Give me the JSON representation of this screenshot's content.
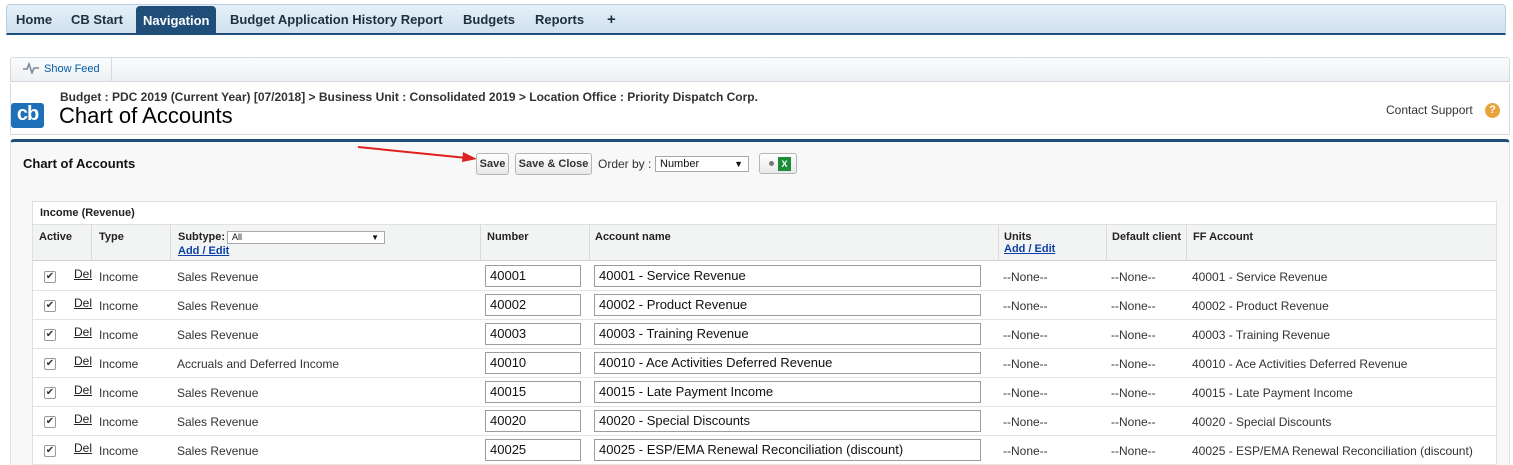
{
  "tabs": [
    {
      "label": "Home",
      "active": false
    },
    {
      "label": "CB Start",
      "active": false
    },
    {
      "label": "Navigation",
      "active": true
    },
    {
      "label": "Budget Application History Report",
      "active": false
    },
    {
      "label": "Budgets",
      "active": false
    },
    {
      "label": "Reports",
      "active": false
    },
    {
      "label": "+",
      "active": false
    }
  ],
  "feed": {
    "label": "Show Feed"
  },
  "header": {
    "logo_text": "cb",
    "breadcrumb": "Budget : PDC 2019 (Current Year) [07/2018] > Business Unit : Consolidated 2019 > Location Office : Priority Dispatch Corp.",
    "title": "Chart of Accounts",
    "support_label": "Contact Support",
    "help_glyph": "?"
  },
  "panel": {
    "title": "Chart of Accounts",
    "save_label": "Save",
    "save_close_label": "Save & Close",
    "order_label": "Order by :",
    "order_value": "Number",
    "excel_icon": "excel-export-icon"
  },
  "section": {
    "title": "Income (Revenue)",
    "headers": {
      "active": "Active",
      "type": "Type",
      "subtype": "Subtype:",
      "subtype_filter": "All",
      "add_edit": "Add / Edit",
      "number": "Number",
      "account_name": "Account name",
      "units": "Units",
      "units_add_edit": "Add / Edit",
      "default_client": "Default client",
      "ff_account": "FF Account"
    },
    "rows": [
      {
        "active": true,
        "del": "Del",
        "type": "Income",
        "subtype": "Sales Revenue",
        "number": "40001",
        "account_name": "40001 - Service Revenue",
        "units": "--None--",
        "default_client": "--None--",
        "ff_account": "40001 - Service Revenue"
      },
      {
        "active": true,
        "del": "Del",
        "type": "Income",
        "subtype": "Sales Revenue",
        "number": "40002",
        "account_name": "40002 - Product Revenue",
        "units": "--None--",
        "default_client": "--None--",
        "ff_account": "40002 - Product Revenue"
      },
      {
        "active": true,
        "del": "Del",
        "type": "Income",
        "subtype": "Sales Revenue",
        "number": "40003",
        "account_name": "40003 - Training Revenue",
        "units": "--None--",
        "default_client": "--None--",
        "ff_account": "40003 - Training Revenue"
      },
      {
        "active": true,
        "del": "Del",
        "type": "Income",
        "subtype": "Accruals and Deferred Income",
        "number": "40010",
        "account_name": "40010 - Ace Activities Deferred Revenue",
        "units": "--None--",
        "default_client": "--None--",
        "ff_account": "40010 - Ace Activities Deferred Revenue"
      },
      {
        "active": true,
        "del": "Del",
        "type": "Income",
        "subtype": "Sales Revenue",
        "number": "40015",
        "account_name": "40015 - Late Payment Income",
        "units": "--None--",
        "default_client": "--None--",
        "ff_account": "40015 - Late Payment Income"
      },
      {
        "active": true,
        "del": "Del",
        "type": "Income",
        "subtype": "Sales Revenue",
        "number": "40020",
        "account_name": "40020 - Special Discounts",
        "units": "--None--",
        "default_client": "--None--",
        "ff_account": "40020 - Special Discounts"
      },
      {
        "active": true,
        "del": "Del",
        "type": "Income",
        "subtype": "Sales Revenue",
        "number": "40025",
        "account_name": "40025 - ESP/EMA Renewal Reconciliation (discount)",
        "units": "--None--",
        "default_client": "--None--",
        "ff_account": "40025 - ESP/EMA Renewal Reconciliation (discount)"
      }
    ]
  },
  "colors": {
    "accent": "#1f4e79",
    "link": "#0b3fa8",
    "arrow": "#e02020"
  }
}
